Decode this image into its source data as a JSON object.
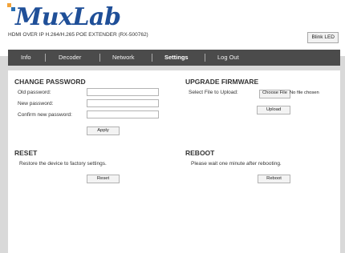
{
  "header": {
    "brand": "MuxLab",
    "subtitle": "HDMI OVER IP H.264/H.265 POE EXTENDER (RX-500762)",
    "blink_led_label": "Blink LED"
  },
  "nav": {
    "items": [
      {
        "label": "Info",
        "active": false
      },
      {
        "label": "Decoder",
        "active": false
      },
      {
        "label": "Network",
        "active": false
      },
      {
        "label": "Settings",
        "active": true
      },
      {
        "label": "Log Out",
        "active": false
      }
    ]
  },
  "change_password": {
    "title": "CHANGE PASSWORD",
    "old_label": "Old password:",
    "old_value": "",
    "new_label": "New password:",
    "new_value": "",
    "confirm_label": "Confirm new password:",
    "confirm_value": "",
    "apply_label": "Apply"
  },
  "upgrade_firmware": {
    "title": "UPGRADE FIRMWARE",
    "select_label": "Select File to Upload:",
    "choose_file_label": "Choose File",
    "file_status": "No file chosen",
    "upload_label": "Upload"
  },
  "reset": {
    "title": "RESET",
    "description": "Restore the device to factory settings.",
    "button_label": "Reset"
  },
  "reboot": {
    "title": "REBOOT",
    "description": "Please wait one minute after rebooting.",
    "button_label": "Reboot"
  },
  "colors": {
    "brand_blue": "#1f4f98",
    "brand_orange": "#f2a33a",
    "nav_bg": "#4b4b4b",
    "page_bg": "#d9d9d9"
  }
}
